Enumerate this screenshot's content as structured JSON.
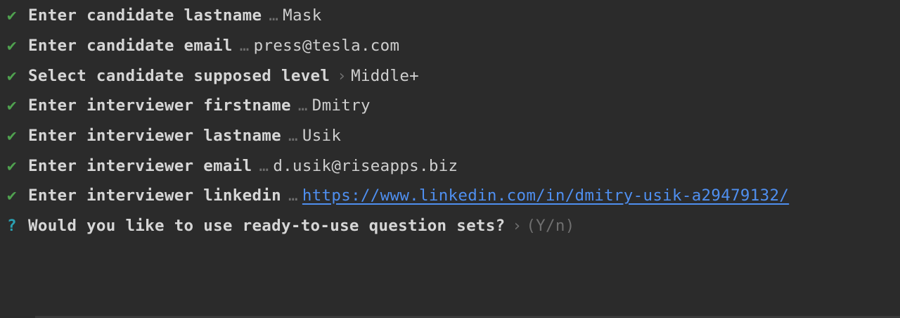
{
  "lines": [
    {
      "status": "done",
      "mark": "✔",
      "prompt": "Enter candidate lastname",
      "separator": "…",
      "answer": "Mask"
    },
    {
      "status": "done",
      "mark": "✔",
      "prompt": "Enter candidate email",
      "separator": "…",
      "answer": "press@tesla.com"
    },
    {
      "status": "done",
      "mark": "✔",
      "prompt": "Select candidate supposed level",
      "separator": "›",
      "answer": "Middle+"
    },
    {
      "status": "done",
      "mark": "✔",
      "prompt": "Enter interviewer firstname",
      "separator": "…",
      "answer": "Dmitry"
    },
    {
      "status": "done",
      "mark": "✔",
      "prompt": "Enter interviewer lastname",
      "separator": "…",
      "answer": "Usik"
    },
    {
      "status": "done",
      "mark": "✔",
      "prompt": "Enter interviewer email",
      "separator": "…",
      "answer": "d.usik@riseapps.biz"
    },
    {
      "status": "done",
      "mark": "✔",
      "prompt": "Enter interviewer linkedin",
      "separator": "…",
      "answer": "https://www.linkedin.com/in/dmitry-usik-a29479132/"
    },
    {
      "status": "active",
      "mark": "?",
      "prompt": "Would you like to use ready-to-use question sets?",
      "separator": "›",
      "answer": "(Y/n)"
    }
  ],
  "colors": {
    "background": "#2b2b2b",
    "check": "#4fa14f",
    "question_mark": "#2aa1b3",
    "prompt_text": "#d6d6d6",
    "link": "#4f8ff0",
    "muted": "#6f6f6f"
  },
  "icons": {
    "done": "check-icon",
    "active": "question-icon"
  }
}
